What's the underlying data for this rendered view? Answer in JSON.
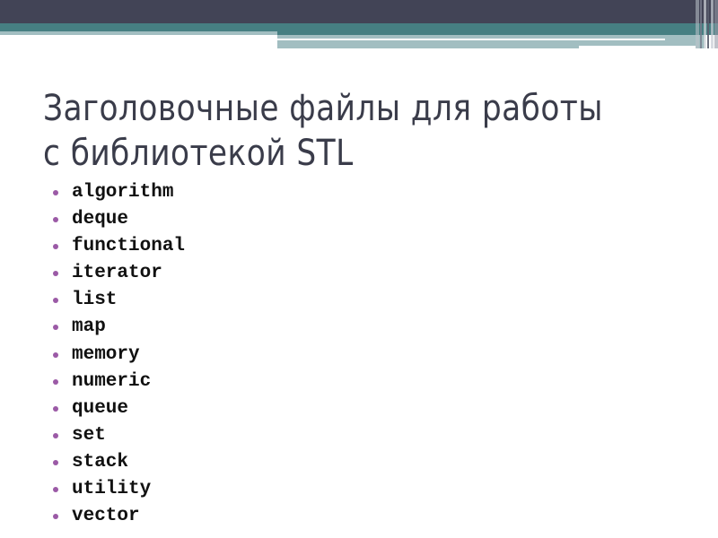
{
  "slide": {
    "title_lines": [
      "Заголовочные файлы для работы",
      "с библиотекой STL"
    ],
    "items": [
      "algorithm",
      "deque",
      "functional",
      "iterator",
      "list",
      "map",
      "memory",
      "numeric",
      "queue",
      "set",
      "stack",
      "utility",
      "vector"
    ],
    "colors": {
      "header_dark": "#424456",
      "header_teal": "#467f82",
      "header_light": "#a2bec1",
      "title_text": "#3a3c4a",
      "bullet": "#9b5aa6"
    }
  }
}
